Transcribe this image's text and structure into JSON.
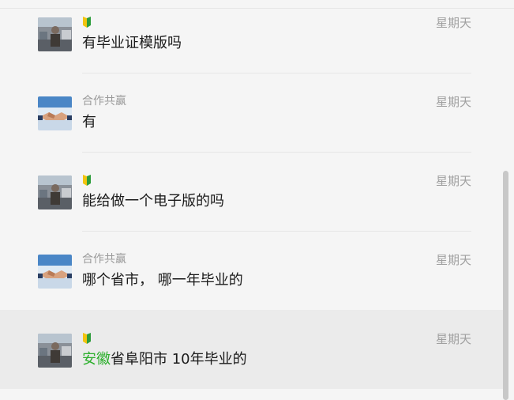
{
  "messages": [
    {
      "sender": "",
      "badge": "beginner-mark-icon",
      "time": "星期天",
      "text": "有毕业证模版吗"
    },
    {
      "sender": "合作共赢",
      "badge": "",
      "time": "星期天",
      "text": "有"
    },
    {
      "sender": "",
      "badge": "beginner-mark-icon",
      "time": "星期天",
      "text": "能给做一个电子版的吗"
    },
    {
      "sender": "合作共赢",
      "badge": "",
      "time": "星期天",
      "text": "哪个省市， 哪一年毕业的"
    },
    {
      "sender": "",
      "badge": "beginner-mark-icon",
      "time": "星期天",
      "text_highlight": "安徽",
      "text_rest": "省阜阳市 10年毕业的"
    }
  ],
  "colors": {
    "highlight": "#2aae2a",
    "selected_bg": "#ebebeb"
  }
}
